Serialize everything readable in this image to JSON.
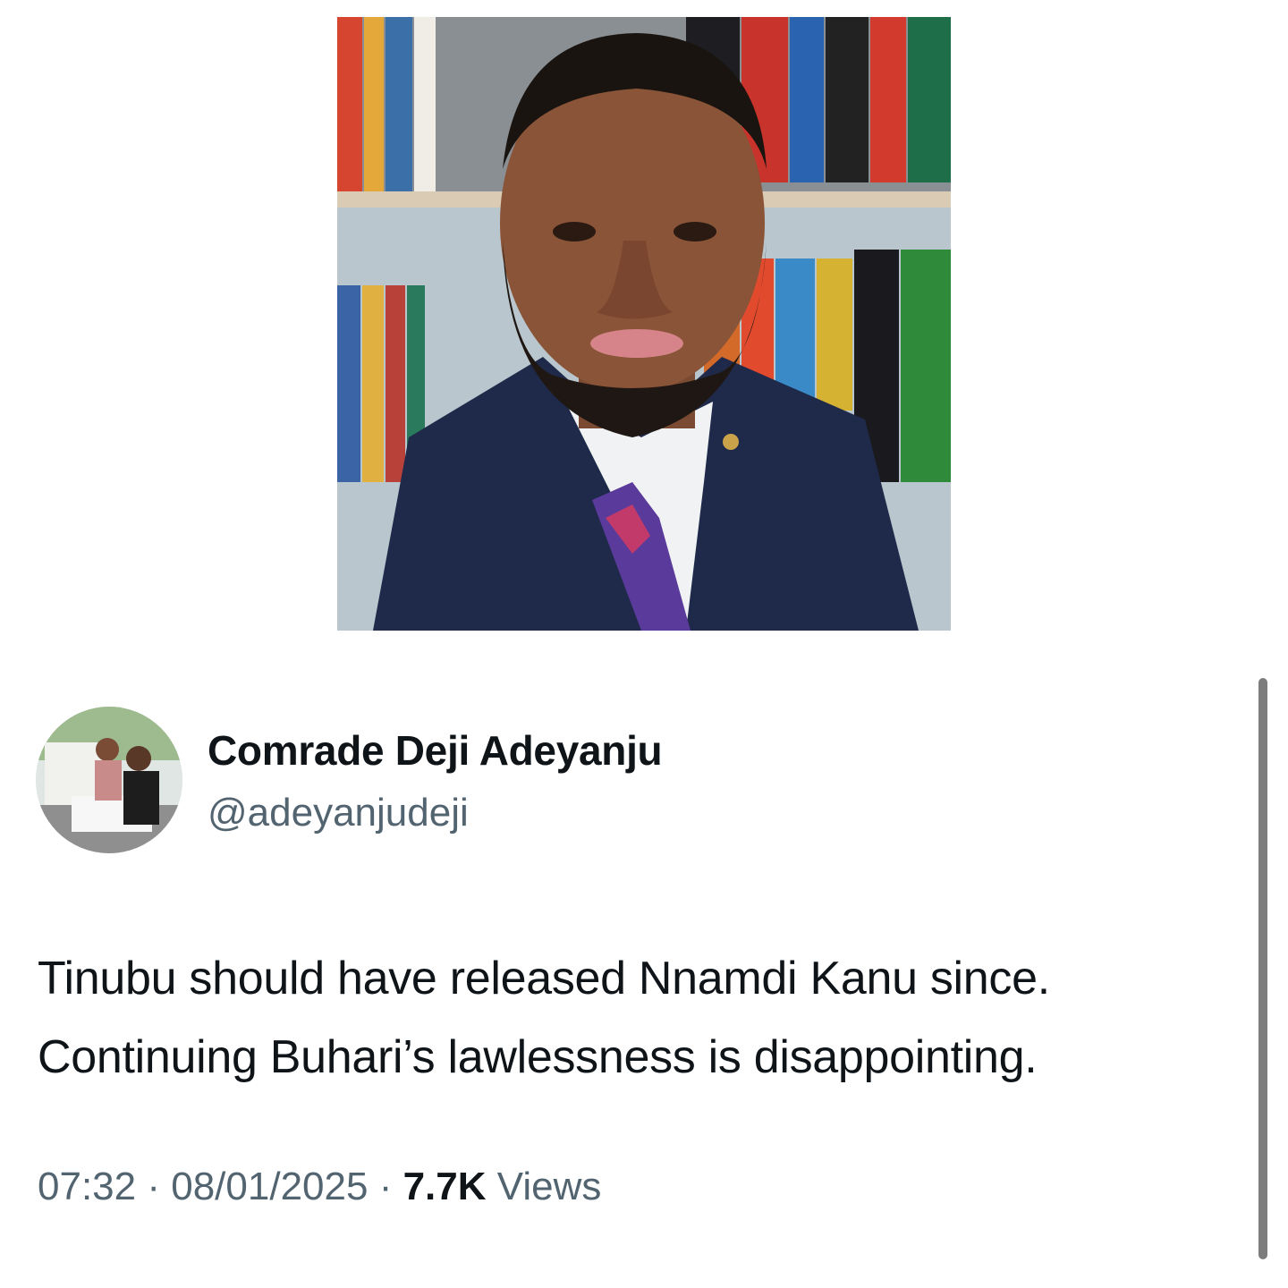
{
  "tweet": {
    "author": {
      "display_name": "Comrade Deji Adeyanju",
      "handle": "@adeyanjudeji"
    },
    "text_lines": [
      "Tinubu should have released Nnamdi Kanu since.",
      "Continuing Buhari’s lawlessness is disappointing."
    ],
    "time": "07:32",
    "separator": "·",
    "date": "08/01/2025",
    "views_count": "7.7K",
    "views_label": "Views"
  },
  "colors": {
    "primary_text": "#0f1419",
    "secondary_text": "#536471",
    "background": "#ffffff"
  }
}
